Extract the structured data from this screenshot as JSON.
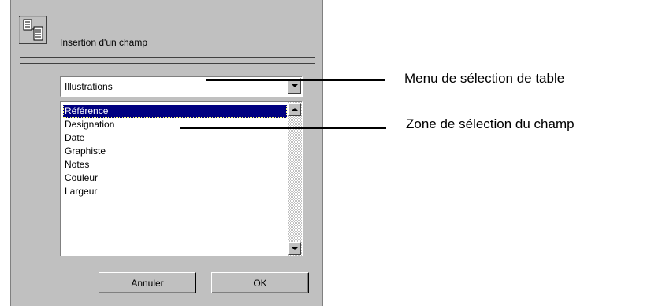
{
  "dialog": {
    "title": "Insertion d'un champ",
    "icon": "table-field-icon",
    "table_menu": {
      "value": "Illustrations",
      "arrow_icon": "chevron-down-icon"
    },
    "field_list": {
      "items": [
        "Référence",
        "Designation",
        "Date",
        "Graphiste",
        "Notes",
        "Couleur",
        "Largeur"
      ],
      "selected_index": 0
    },
    "buttons": {
      "cancel": "Annuler",
      "ok": "OK"
    }
  },
  "callouts": {
    "table_menu": "Menu de sélection de table",
    "field_zone": "Zone de sélection du champ"
  },
  "colors": {
    "window_bg": "#c0c0c0",
    "selection": "#000080"
  }
}
